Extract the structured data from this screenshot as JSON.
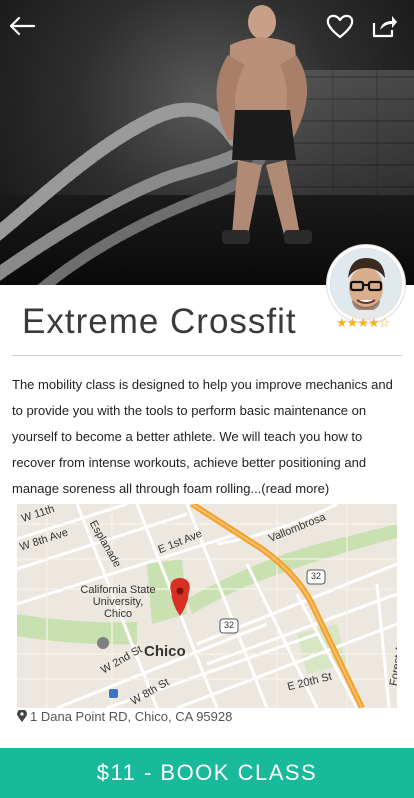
{
  "header": {
    "back_icon": "arrow-left-icon",
    "favorite_icon": "heart-icon",
    "share_icon": "share-icon"
  },
  "class": {
    "title": "Extreme Crossfit",
    "rating": 4,
    "rating_max": 5,
    "description": "The mobility class is designed to help you improve mechanics and to provide you with the tools to perform basic maintenance on yourself to become a better athlete. We will teach you how to recover from intense workouts, achieve better positioning and manage soreness all through foam rolling...(read more)"
  },
  "map": {
    "city_label": "Chico",
    "university_label": "California State University, Chico",
    "street_labels": [
      "W 11th",
      "W 8th Ave",
      "Esplanade",
      "E 1st Ave",
      "Vallombrosa",
      "W 2nd St",
      "W 8th St",
      "E 20th St",
      "Forest Ave"
    ],
    "route_badges": [
      "32",
      "32"
    ],
    "colors": {
      "highway": "#f3a02c",
      "park": "#c9e0b0",
      "water": "#aad3df",
      "marker": "#d93025"
    }
  },
  "address": "1 Dana Point RD, Chico, CA 95928",
  "cta": {
    "label": "$11 - BOOK CLASS",
    "color": "#19b99c"
  }
}
